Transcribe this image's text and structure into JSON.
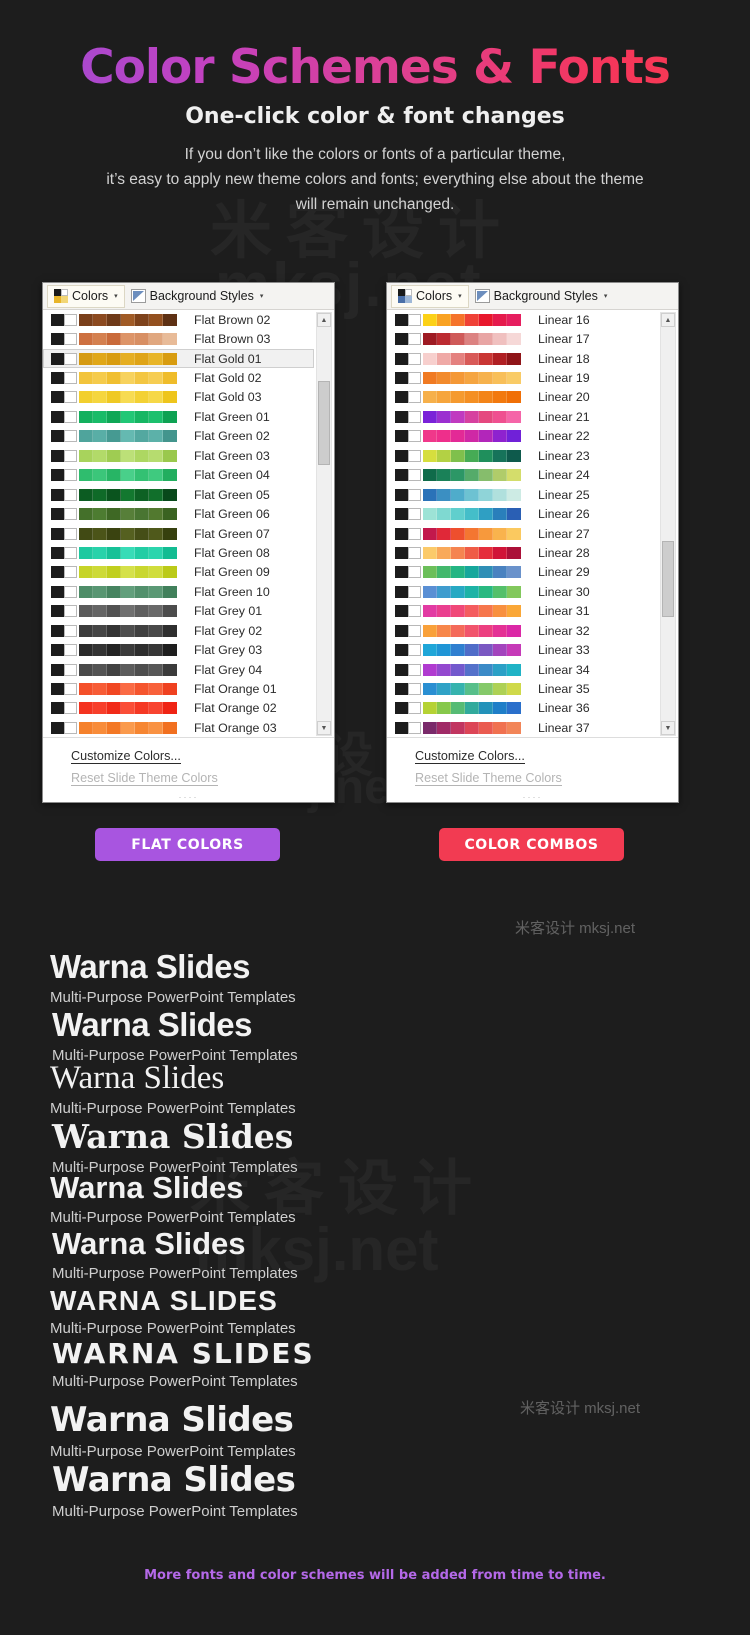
{
  "header": {
    "title": "Color Schemes & Fonts",
    "subtitle": "One-click color & font changes",
    "body_line1": "If you don’t like the colors or fonts of a particular theme,",
    "body_line2": "it’s easy to apply new theme colors and fonts; everything else about the theme",
    "body_line3": "will remain unchanged.",
    "title_gradient_start": "#9b4dd6",
    "title_gradient_end": "#fa3b4e"
  },
  "watermarks": {
    "cjk": "米客设计",
    "latin": "mksj.net",
    "combined": "米客设计 mksj.net"
  },
  "panels": [
    {
      "id": "flat-colors",
      "ribbon": {
        "colors_label": "Colors",
        "background_styles_label": "Background Styles",
        "caret": "▾"
      },
      "items": [
        {
          "label": "Flat Brown 02",
          "selected": false,
          "ramp": [
            "#7a3f1a",
            "#8c4a20",
            "#6f3a18",
            "#a05b26",
            "#7e421b",
            "#93501f",
            "#5e3114"
          ]
        },
        {
          "label": "Flat Brown 03",
          "selected": false,
          "ramp": [
            "#cd7040",
            "#d4804f",
            "#c96a3a",
            "#dd9468",
            "#d88f63",
            "#e0a77f",
            "#e8bb98"
          ]
        },
        {
          "label": "Flat Gold 01",
          "selected": true,
          "ramp": [
            "#d59a12",
            "#e0a718",
            "#d89c10",
            "#e5ae22",
            "#dfa417",
            "#e8b528",
            "#d89c10"
          ]
        },
        {
          "label": "Flat Gold 02",
          "selected": false,
          "ramp": [
            "#f2c43c",
            "#f5cb4b",
            "#f0bf30",
            "#f7d25d",
            "#f3c642",
            "#f6cd52",
            "#efbc2a"
          ]
        },
        {
          "label": "Flat Gold 03",
          "selected": false,
          "ramp": [
            "#f2cf2e",
            "#f5d63f",
            "#efc923",
            "#f7db52",
            "#f3d134",
            "#f6d847",
            "#eec51c"
          ]
        },
        {
          "label": "Flat Green 01",
          "selected": false,
          "ramp": [
            "#13b05e",
            "#19bb68",
            "#0fa756",
            "#22c776",
            "#16b663",
            "#1cc06d",
            "#0ea253"
          ]
        },
        {
          "label": "Flat Green 02",
          "selected": false,
          "ramp": [
            "#4fa49c",
            "#59aea6",
            "#469a92",
            "#65b9b1",
            "#53a8a0",
            "#5cb1a9",
            "#43958d"
          ]
        },
        {
          "label": "Flat Green 03",
          "selected": false,
          "ramp": [
            "#a8d35c",
            "#b2da69",
            "#9fcc52",
            "#bce078",
            "#add762",
            "#b6dc6f",
            "#9ac84d"
          ]
        },
        {
          "label": "Flat Green 04",
          "selected": false,
          "ramp": [
            "#2fbd6e",
            "#3bc67a",
            "#27b565",
            "#49d08a",
            "#33c173",
            "#3fca7f",
            "#22ae5f"
          ]
        },
        {
          "label": "Flat Green 05",
          "selected": false,
          "ramp": [
            "#0c5c22",
            "#0f6a28",
            "#0a541e",
            "#13782f",
            "#0d6124",
            "#116f2b",
            "#08491b"
          ]
        },
        {
          "label": "Flat Green 06",
          "selected": false,
          "ramp": [
            "#44702a",
            "#4d7c31",
            "#3e6824",
            "#577f39",
            "#497532",
            "#52792f",
            "#3a6321"
          ]
        },
        {
          "label": "Flat Green 07",
          "selected": false,
          "ramp": [
            "#414a14",
            "#4b5418",
            "#3a4310",
            "#556020",
            "#454e17",
            "#4f591b",
            "#36400e"
          ]
        },
        {
          "label": "Flat Green 08",
          "selected": false,
          "ramp": [
            "#1ec9a0",
            "#28d2aa",
            "#16c197",
            "#38dcb7",
            "#22cda4",
            "#2bd5ad",
            "#12bc92"
          ]
        },
        {
          "label": "Flat Green 09",
          "selected": false,
          "ramp": [
            "#c6d428",
            "#cdda37",
            "#c0cf1e",
            "#d5e14a",
            "#c9d72f",
            "#d0dd3c",
            "#bbca18"
          ]
        },
        {
          "label": "Flat Green 10",
          "selected": false,
          "ramp": [
            "#4e8d68",
            "#589672",
            "#468460",
            "#629f7c",
            "#52906c",
            "#5b9975",
            "#41805b"
          ]
        },
        {
          "label": "Flat Grey 01",
          "selected": false,
          "ramp": [
            "#5b5b5b",
            "#656565",
            "#525252",
            "#707070",
            "#5f5f5f",
            "#696969",
            "#4c4c4c"
          ]
        },
        {
          "label": "Flat Grey 02",
          "selected": false,
          "ramp": [
            "#3c3c3c",
            "#454545",
            "#343434",
            "#4e4e4e",
            "#404040",
            "#494949",
            "#2e2e2e"
          ]
        },
        {
          "label": "Flat Grey 03",
          "selected": false,
          "ramp": [
            "#2a2a2a",
            "#333333",
            "#232323",
            "#3b3b3b",
            "#2e2e2e",
            "#373737",
            "#1e1e1e"
          ]
        },
        {
          "label": "Flat Grey 04",
          "selected": false,
          "ramp": [
            "#4a4a4a",
            "#535353",
            "#424242",
            "#5c5c5c",
            "#4e4e4e",
            "#575757",
            "#3b3b3b"
          ]
        },
        {
          "label": "Flat Orange 01",
          "selected": false,
          "ramp": [
            "#f4502a",
            "#f75c36",
            "#f14722",
            "#fa6b45",
            "#f5552e",
            "#f8613b",
            "#ef4120"
          ]
        },
        {
          "label": "Flat Orange 02",
          "selected": false,
          "ramp": [
            "#f43320",
            "#f73f2b",
            "#f12a18",
            "#fa4e38",
            "#f53824",
            "#f84430",
            "#ef2414"
          ]
        },
        {
          "label": "Flat Orange 03",
          "selected": false,
          "ramp": [
            "#f5812c",
            "#f88c3a",
            "#f37825",
            "#fa9a4d",
            "#f68632",
            "#f99243",
            "#f17020"
          ]
        }
      ],
      "footer": {
        "customize": "Customize Colors...",
        "reset": "Reset Slide Theme Colors",
        "reset_disabled": true
      },
      "scrollbar": {
        "up": "▲",
        "down": "▼",
        "thumb_top_pct": 11,
        "thumb_height_pct": 20
      },
      "pill": {
        "label": "FLAT COLORS",
        "color": "#a855e0"
      }
    },
    {
      "id": "color-combos",
      "ribbon": {
        "colors_label": "Colors",
        "background_styles_label": "Background Styles",
        "caret": "▾"
      },
      "items": [
        {
          "label": "Linear 16",
          "selected": false,
          "ramp": [
            "#fcd117",
            "#f9a222",
            "#f5732b",
            "#ef4136",
            "#e8172c",
            "#e51a4c",
            "#e61e5f"
          ]
        },
        {
          "label": "Linear 17",
          "selected": false,
          "ramp": [
            "#9e1b23",
            "#bc2b31",
            "#cf5a59",
            "#dc8281",
            "#e8a5a4",
            "#f0c0bf",
            "#f6d8d7"
          ]
        },
        {
          "label": "Linear 18",
          "selected": false,
          "ramp": [
            "#f7cfcd",
            "#efa9a6",
            "#e4817f",
            "#d85a58",
            "#c93634",
            "#b01f23",
            "#8f1418"
          ]
        },
        {
          "label": "Linear 19",
          "selected": false,
          "ramp": [
            "#f07a22",
            "#f28a2c",
            "#f49836",
            "#f5a541",
            "#f6b24d",
            "#f8bf59",
            "#f9cb66"
          ]
        },
        {
          "label": "Linear 20",
          "selected": false,
          "ramp": [
            "#f6b04a",
            "#f6a53c",
            "#f59a2f",
            "#f48f23",
            "#f38418",
            "#f2790e",
            "#f06f06"
          ]
        },
        {
          "label": "Linear 21",
          "selected": false,
          "ramp": [
            "#7a22d8",
            "#9b2fd0",
            "#c03ac0",
            "#d6419f",
            "#e5487f",
            "#ef5090",
            "#f565a8"
          ]
        },
        {
          "label": "Linear 22",
          "selected": false,
          "ramp": [
            "#f0388a",
            "#ee2f8b",
            "#e32a96",
            "#cf28a5",
            "#b226ba",
            "#8e22cf",
            "#7021d8"
          ]
        },
        {
          "label": "Linear 23",
          "selected": false,
          "ramp": [
            "#d6de3e",
            "#b3d144",
            "#7fc04c",
            "#46ab55",
            "#1f8f5c",
            "#16735a",
            "#0e5a4c"
          ]
        },
        {
          "label": "Linear 24",
          "selected": false,
          "ramp": [
            "#0f6b4a",
            "#1a8158",
            "#2c9766",
            "#55ab6a",
            "#86bd6c",
            "#b0cc6a",
            "#d4dd6b"
          ]
        },
        {
          "label": "Linear 25",
          "selected": false,
          "ramp": [
            "#2a72b8",
            "#3b8fc2",
            "#4faccb",
            "#6dc2d2",
            "#8fd4d8",
            "#b0e0dd",
            "#cdebe4"
          ]
        },
        {
          "label": "Linear 26",
          "selected": false,
          "ramp": [
            "#9de3d6",
            "#7fd9d1",
            "#60cfcd",
            "#44bec9",
            "#2f9fc3",
            "#2a7fbb",
            "#2a5fb4"
          ]
        },
        {
          "label": "Linear 27",
          "selected": false,
          "ramp": [
            "#c2184c",
            "#e02838",
            "#ee4f2e",
            "#f47631",
            "#f7993c",
            "#f9b34d",
            "#fbc95f"
          ]
        },
        {
          "label": "Linear 28",
          "selected": false,
          "ramp": [
            "#fbca6a",
            "#f9a95a",
            "#f58450",
            "#ef5c46",
            "#e52e3b",
            "#d01438",
            "#ab1038"
          ]
        },
        {
          "label": "Linear 29",
          "selected": false,
          "ramp": [
            "#6cbf5a",
            "#43b86c",
            "#24b583",
            "#16a79c",
            "#2f8fb6",
            "#4a82c0",
            "#6a92cb"
          ]
        },
        {
          "label": "Linear 30",
          "selected": false,
          "ramp": [
            "#5a8fd4",
            "#3f9cce",
            "#27a9c3",
            "#1db3a6",
            "#29b981",
            "#54c06a",
            "#82c85c"
          ]
        },
        {
          "label": "Linear 31",
          "selected": false,
          "ramp": [
            "#e23ba3",
            "#ea3f8f",
            "#f04878",
            "#f45c5f",
            "#f6764c",
            "#f8903f",
            "#faa737"
          ]
        },
        {
          "label": "Linear 32",
          "selected": false,
          "ramp": [
            "#f9a13a",
            "#f7864a",
            "#f46a5a",
            "#f1546c",
            "#ec3f80",
            "#e43195",
            "#db28a6"
          ]
        },
        {
          "label": "Linear 33",
          "selected": false,
          "ramp": [
            "#1fa6d8",
            "#1f95d6",
            "#2f7fd0",
            "#4f6cc8",
            "#7a58c2",
            "#a344bd",
            "#c63ab8"
          ]
        },
        {
          "label": "Linear 34",
          "selected": false,
          "ramp": [
            "#b03bd0",
            "#9349cf",
            "#7359cd",
            "#5471ca",
            "#3b8ac7",
            "#2ba0c6",
            "#20b3c6"
          ]
        },
        {
          "label": "Linear 35",
          "selected": false,
          "ramp": [
            "#2a8fd2",
            "#2fa2c6",
            "#36b3ae",
            "#57bf8a",
            "#85c96a",
            "#aed155",
            "#cfd94a"
          ]
        },
        {
          "label": "Linear 36",
          "selected": false,
          "ramp": [
            "#b5d234",
            "#86c84b",
            "#56bb74",
            "#31aa9c",
            "#2392ba",
            "#1f7ec8",
            "#2a6fcb"
          ]
        },
        {
          "label": "Linear 37",
          "selected": false,
          "ramp": [
            "#7a2a6a",
            "#a02a66",
            "#c13560",
            "#dc4556",
            "#ea5b50",
            "#f07150",
            "#f28558"
          ]
        }
      ],
      "footer": {
        "customize": "Customize Colors...",
        "reset": "Reset Slide Theme Colors",
        "reset_disabled": true
      },
      "scrollbar": {
        "up": "▲",
        "down": "▼",
        "thumb_top_pct": 54,
        "thumb_height_pct": 18
      },
      "pill": {
        "label": "COLOR COMBOS",
        "color": "#f23b52"
      }
    }
  ],
  "font_samples": {
    "title": "Warna Slides",
    "title_upper": "WARNA SLIDES",
    "subtitle": "Multi-Purpose PowerPoint Templates",
    "rows": [
      {
        "left_title": "Warna Slides",
        "right_title": "Warna Slides"
      },
      {
        "left_title": "Warna Slides",
        "right_title": "Warna Slides"
      },
      {
        "left_title": "Warna Slides",
        "right_title": "Warna Slides"
      },
      {
        "left_title": "WARNA SLIDES",
        "right_title": "WARNA SLIDES"
      },
      {
        "left_title": "Warna Slides",
        "right_title": "Warna Slides"
      }
    ]
  },
  "footer_note": {
    "text": "More fonts and color schemes will be added from time to time.",
    "color": "#b469e8"
  }
}
